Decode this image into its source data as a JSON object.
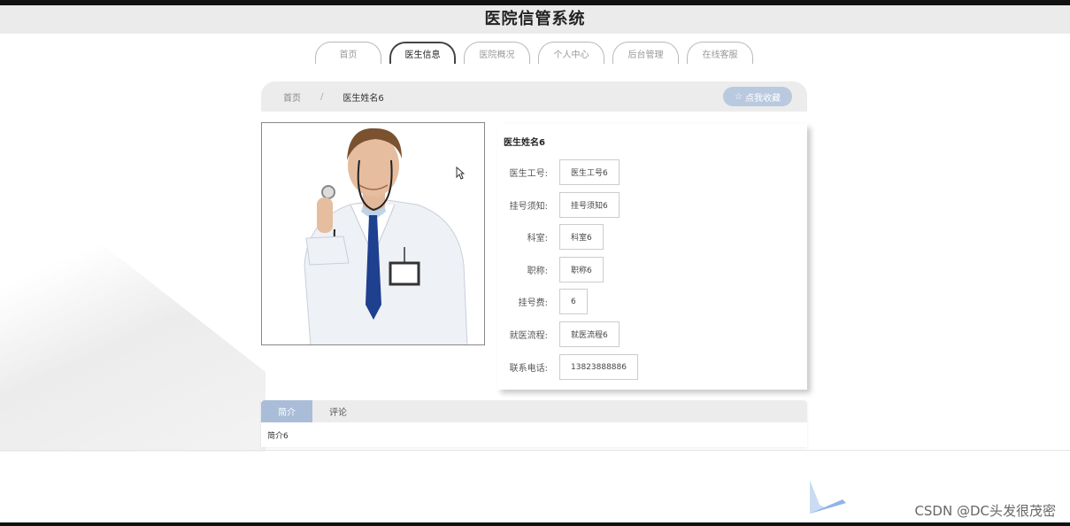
{
  "app": {
    "title": "医院信管系统"
  },
  "nav": {
    "items": [
      {
        "label": "首页"
      },
      {
        "label": "医生信息"
      },
      {
        "label": "医院概况"
      },
      {
        "label": "个人中心"
      },
      {
        "label": "后台管理"
      },
      {
        "label": "在线客服"
      }
    ],
    "active_index": 1
  },
  "breadcrumb": {
    "home": "首页",
    "separator": "/",
    "current": "医生姓名6"
  },
  "favorite": {
    "icon": "star-outline-icon",
    "label": "点我收藏"
  },
  "doctor": {
    "name": "医生姓名6",
    "fields": [
      {
        "label": "医生工号:",
        "value": "医生工号6"
      },
      {
        "label": "挂号须知:",
        "value": "挂号须知6"
      },
      {
        "label": "科室:",
        "value": "科室6"
      },
      {
        "label": "职称:",
        "value": "职称6"
      },
      {
        "label": "挂号费:",
        "value": "6"
      },
      {
        "label": "就医流程:",
        "value": "就医流程6"
      },
      {
        "label": "联系电话:",
        "value": "13823888886"
      }
    ]
  },
  "tabs": {
    "items": [
      {
        "label": "简介"
      },
      {
        "label": "评论"
      }
    ],
    "active_index": 0,
    "content": "简介6"
  },
  "watermark": "CSDN @DC头发很茂密",
  "colors": {
    "accent": "#a9bdd8",
    "header_bg": "#ebebeb"
  }
}
